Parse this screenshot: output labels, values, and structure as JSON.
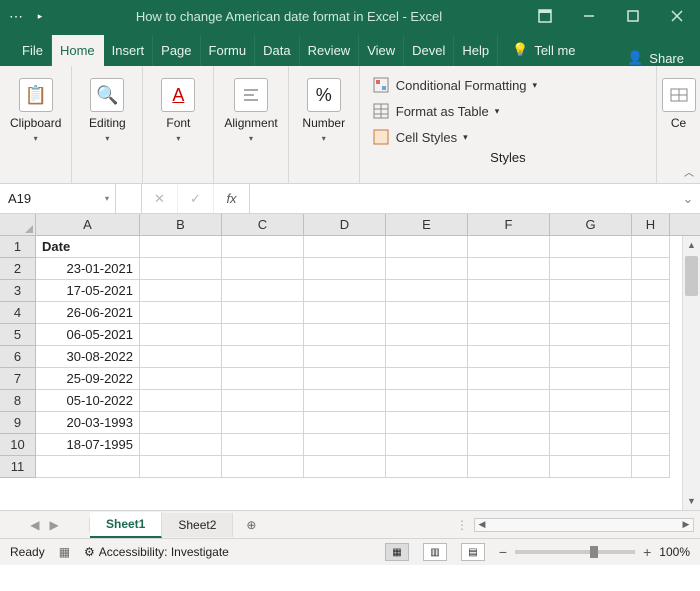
{
  "titlebar": {
    "title": "How to change American date format in Excel  -  Excel"
  },
  "menu": {
    "tabs": [
      "File",
      "Home",
      "Insert",
      "Page",
      "Formu",
      "Data",
      "Review",
      "View",
      "Devel",
      "Help"
    ],
    "active": 1,
    "tellme": "Tell me",
    "share": "Share"
  },
  "ribbon": {
    "groups": {
      "clipboard": "Clipboard",
      "editing": "Editing",
      "font": "Font",
      "alignment": "Alignment",
      "number": "Number",
      "styles": "Styles",
      "cells": "Ce"
    },
    "style_items": {
      "cond": "Conditional Formatting",
      "table": "Format as Table",
      "cellstyles": "Cell Styles"
    }
  },
  "formula": {
    "namebox": "A19",
    "fx": "fx",
    "value": ""
  },
  "columns": [
    "A",
    "B",
    "C",
    "D",
    "E",
    "F",
    "G",
    "H"
  ],
  "rows": [
    {
      "n": 1,
      "A": "Date",
      "header": true
    },
    {
      "n": 2,
      "A": "23-01-2021"
    },
    {
      "n": 3,
      "A": "17-05-2021"
    },
    {
      "n": 4,
      "A": "26-06-2021"
    },
    {
      "n": 5,
      "A": "06-05-2021"
    },
    {
      "n": 6,
      "A": "30-08-2022"
    },
    {
      "n": 7,
      "A": "25-09-2022"
    },
    {
      "n": 8,
      "A": "05-10-2022"
    },
    {
      "n": 9,
      "A": "20-03-1993"
    },
    {
      "n": 10,
      "A": "18-07-1995"
    },
    {
      "n": 11,
      "A": ""
    }
  ],
  "sheets": {
    "tabs": [
      "Sheet1",
      "Sheet2"
    ],
    "active": 0
  },
  "status": {
    "ready": "Ready",
    "accessibility": "Accessibility: Investigate",
    "zoom": "100%"
  }
}
